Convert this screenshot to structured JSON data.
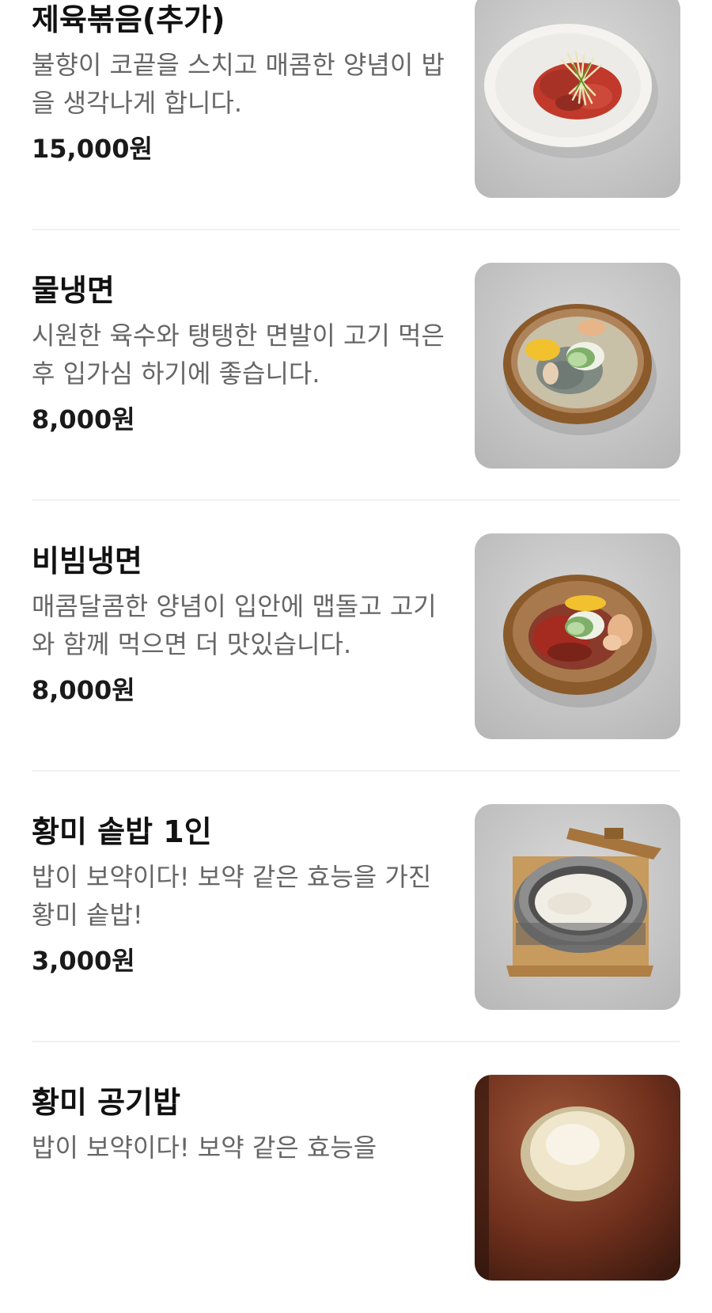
{
  "menu": {
    "items": [
      {
        "name": "제육볶음(추가)",
        "description": "불향이 코끝을 스치고 매콤한 양념이 밥을 생각나게 합니다.",
        "price": "15,000원",
        "photo_icon": "spicy-pork-plate-photo"
      },
      {
        "name": "물냉면",
        "description": "시원한 육수와 탱탱한 면발이 고기 먹은 후 입가심 하기에 좋습니다.",
        "price": "8,000원",
        "photo_icon": "cold-noodle-bowl-photo"
      },
      {
        "name": "비빔냉면",
        "description": "매콤달콤한 양념이 입안에 맵돌고 고기와 함께 먹으면 더 맛있습니다.",
        "price": "8,000원",
        "photo_icon": "spicy-noodle-bowl-photo"
      },
      {
        "name": "황미 솥밥 1인",
        "description": "밥이 보약이다! 보약 같은 효능을 가진 황미 솥밥!",
        "price": "3,000원",
        "photo_icon": "pot-rice-photo"
      },
      {
        "name": "황미 공기밥",
        "description": "밥이 보약이다! 보약 같은 효능을",
        "price": "",
        "photo_icon": "rice-bowl-photo"
      }
    ]
  },
  "colors": {
    "title": "#111111",
    "description": "#666666",
    "divider": "#f1f1f1",
    "photo_background": "#cfcfcf"
  }
}
